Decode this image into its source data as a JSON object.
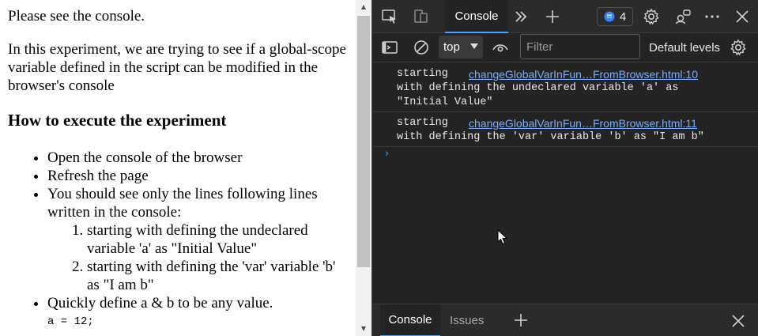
{
  "page": {
    "intro": "Please see the console.",
    "description": "In this experiment, we are trying to see if a global-scope variable defined in the script can be modified in the browser's console",
    "heading": "How to execute the experiment",
    "steps": [
      "Open the console of the browser",
      "Refresh the page",
      "You should see only the lines following lines written in the console:"
    ],
    "expected_lines": [
      "starting with defining the undeclared variable 'a' as \"Initial Value\"",
      "starting with defining the 'var' variable 'b' as \"I am b\""
    ],
    "final_step": "Quickly define a & b to be any value.",
    "code_line": "a = 12;"
  },
  "devtools": {
    "main_tab": "Console",
    "issues_count": "4",
    "context": "top",
    "filter_placeholder": "Filter",
    "levels_label": "Default levels",
    "messages": [
      {
        "line1": "starting",
        "source": "changeGlobalVarInFun…FromBrowser.html:10",
        "cont": [
          "with defining the undeclared variable 'a' as",
          "\"Initial Value\""
        ]
      },
      {
        "line1": "starting",
        "source": "changeGlobalVarInFun…FromBrowser.html:11",
        "cont": [
          "with defining the 'var' variable 'b' as \"I am b\""
        ]
      }
    ],
    "drawer_tabs": [
      "Console",
      "Issues"
    ]
  },
  "colors": {
    "devtools_bg": "#242424",
    "accent_blue": "#4fa3f7",
    "link_blue": "#7cacf8",
    "badge_blue": "#3b82f6"
  }
}
